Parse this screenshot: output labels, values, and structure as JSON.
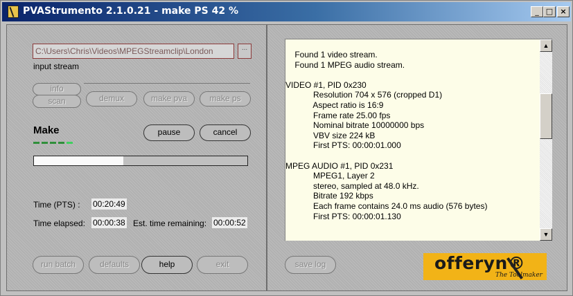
{
  "window": {
    "title": "PVAStrumento 2.1.0.21 - make PS 42 %",
    "controls": {
      "minimize": "_",
      "maximize": "□",
      "close": "×"
    }
  },
  "input": {
    "path": "C:\\Users\\Chris\\Videos\\MPEGStreamclip\\London",
    "browse_label": "...",
    "label": "input stream"
  },
  "buttons": {
    "info": "info",
    "scan": "scan",
    "demux": "demux",
    "make_pva": "make pva",
    "make_ps": "make ps",
    "pause": "pause",
    "cancel": "cancel",
    "run_batch": "run batch",
    "defaults": "defaults",
    "help": "help",
    "exit": "exit",
    "save_log": "save log"
  },
  "make": {
    "title": "Make",
    "progress_percent": 42
  },
  "time": {
    "pts_label": "Time (PTS) :",
    "pts_value": "00:20:49",
    "elapsed_label": "Time elapsed:",
    "elapsed_value": "00:00:38",
    "remaining_label": "Est. time remaining:",
    "remaining_value": "00:00:52"
  },
  "log": {
    "lines": [
      "    Found 1 video stream.",
      "    Found 1 MPEG audio stream.",
      "",
      "VIDEO #1, PID 0x230",
      "            Resolution 704 x 576 (cropped D1)",
      "            Aspect ratio is 16:9",
      "            Frame rate 25.00 fps",
      "            Nominal bitrate 10000000 bps",
      "            VBV size 224 kB",
      "            First PTS: 00:00:01.000",
      "",
      "MPEG AUDIO #1, PID 0x231",
      "            MPEG1, Layer 2",
      "            stereo, sampled at 48.0 kHz.",
      "            Bitrate 192 kbps",
      "            Each frame contains 24.0 ms audio (576 bytes)",
      "            First PTS: 00:00:01.130"
    ]
  },
  "logo": {
    "name": "offeryn®",
    "tagline": "The Toolmaker"
  },
  "colors": {
    "titlebar_start": "#0a246a",
    "panel": "#b8b8b8",
    "log_background": "#fdfde8",
    "logo_background": "#f2b317",
    "progress_dash": "#2f8f3a"
  }
}
